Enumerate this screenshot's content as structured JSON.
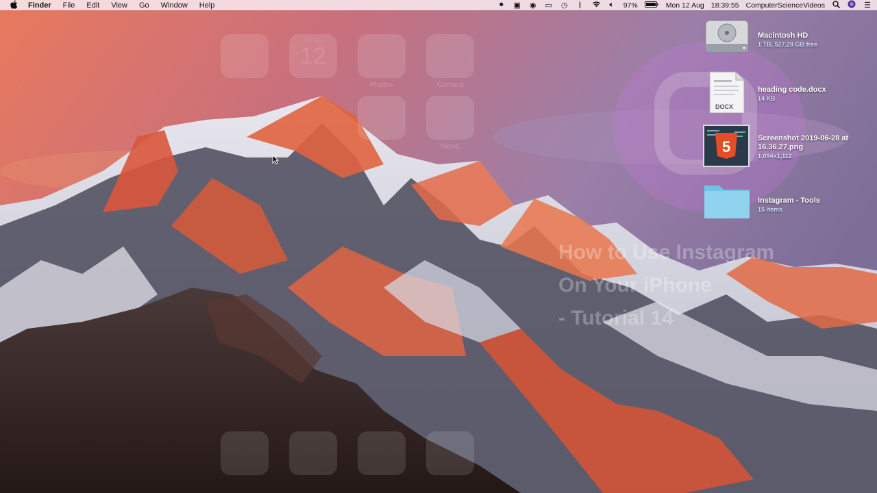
{
  "menubar": {
    "app_name": "Finder",
    "menus": [
      "File",
      "Edit",
      "View",
      "Go",
      "Window",
      "Help"
    ],
    "battery": "97%",
    "date": "Mon 12 Aug",
    "time": "18:39:55",
    "user": "ComputerScienceVideos",
    "status_icons": [
      "screen-record-icon",
      "camera-icon",
      "accessibility-icon",
      "airplay-icon",
      "time-machine-icon",
      "bluetooth-icon",
      "wifi-icon",
      "volume-icon",
      "battery-icon",
      "search-icon",
      "siri-icon",
      "list-icon"
    ]
  },
  "desktop_items": [
    {
      "name": "Macintosh HD",
      "meta": "1 TB, 527.28 GB free",
      "icon": "hard-drive-icon"
    },
    {
      "name": "heading code.docx",
      "meta": "14 KB",
      "icon": "docx-file-icon",
      "badge": "DOCX"
    },
    {
      "name": "Screenshot 2019-06-28 at 16.36.27.png",
      "meta": "1,094×1,112",
      "icon": "image-file-icon"
    },
    {
      "name": "Instagram - Tools",
      "meta": "15 items",
      "icon": "folder-icon"
    }
  ],
  "overlay": {
    "phone_date_number": "12",
    "phone_date_day": "Monday",
    "app_labels": [
      "Photos",
      "Camera",
      "News"
    ],
    "video_title_lines": [
      "How to Use Instagram",
      "On Your iPhone",
      "- Tutorial 14"
    ]
  },
  "colors": {
    "menubar_bg": "#f8e8ee",
    "folder_blue": "#8fd3ee",
    "html5_orange": "#e44d26"
  }
}
